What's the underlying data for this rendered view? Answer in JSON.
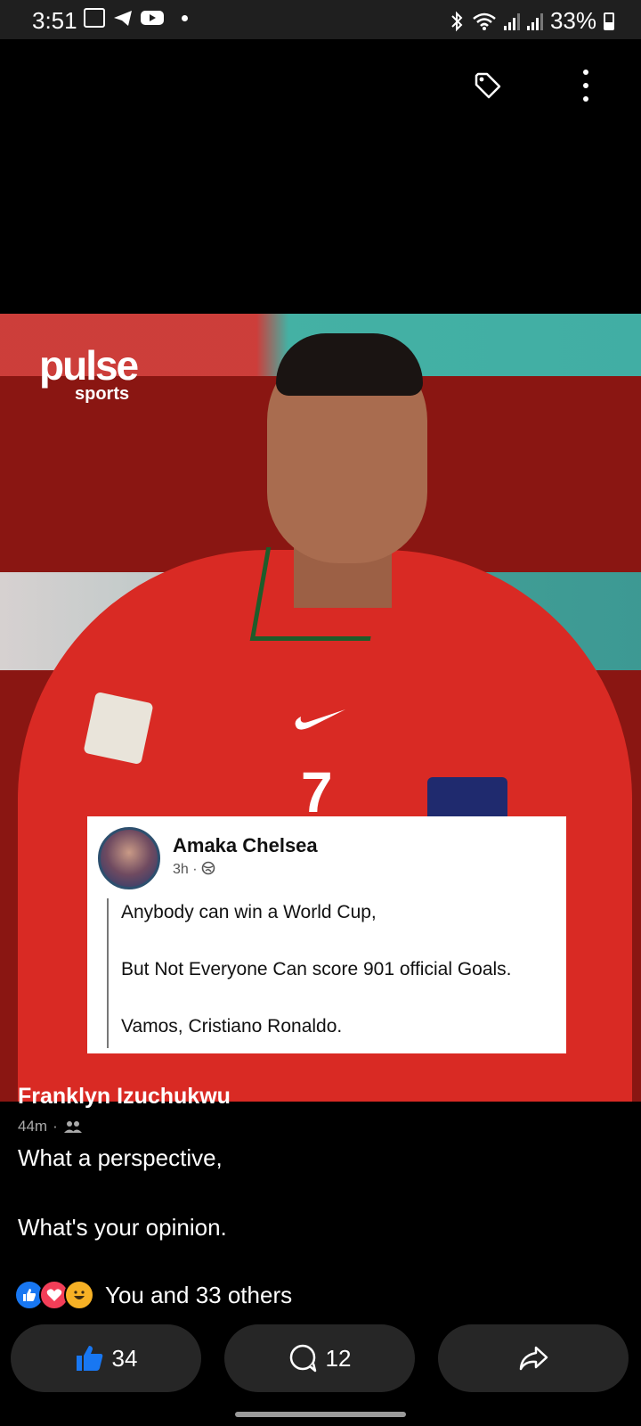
{
  "status_bar": {
    "time": "3:51",
    "battery": "33%"
  },
  "post": {
    "image": {
      "logo_text": "pulse",
      "logo_sub": "sports",
      "jersey_number": "7",
      "quote": {
        "name": "Amaka Chelsea",
        "time": "3h",
        "lines": [
          "Anybody can win a World Cup,",
          "But Not Everyone Can score 901 official Goals.",
          "Vamos, Cristiano Ronaldo."
        ]
      }
    },
    "author": "Franklyn Izuchukwu",
    "time": "44m",
    "caption_line1": "What a perspective,",
    "caption_line2": "What's your opinion.",
    "reactions_text": "You and 33 others",
    "actions": {
      "like_count": "34",
      "comment_count": "12"
    }
  },
  "colors": {
    "like_blue": "#1877f2",
    "love_red": "#f33e58",
    "haha_yellow": "#f7b125",
    "button_bg": "#262626"
  },
  "icons": [
    "tag-icon",
    "more-options-icon",
    "like-icon",
    "comment-icon",
    "share-icon",
    "friends-icon",
    "globe-icon"
  ]
}
